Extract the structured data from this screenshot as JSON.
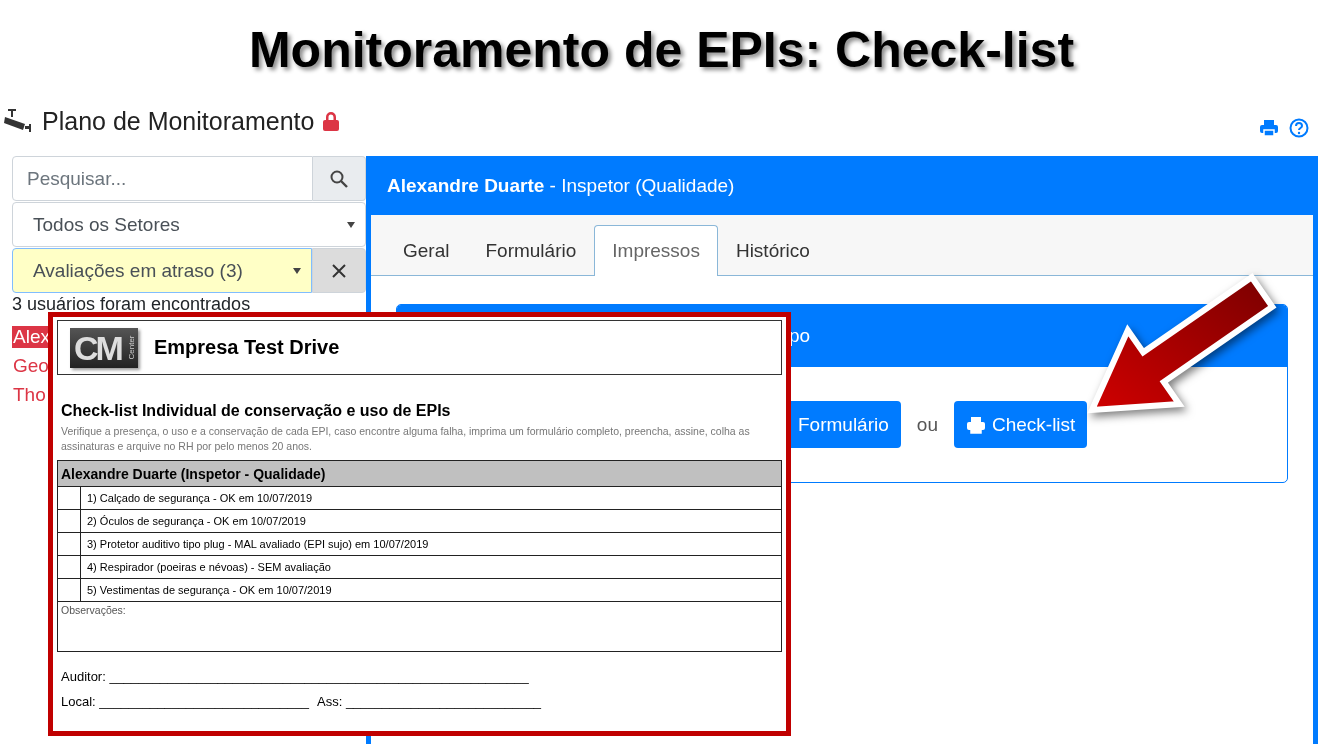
{
  "slide_title": "Monitoramento de EPIs: Check-list",
  "app": {
    "title": "Plano de Monitoramento",
    "locked": true
  },
  "sidebar": {
    "search": {
      "placeholder": "Pesquisar..."
    },
    "sector_select": {
      "value": "Todos os Setores",
      "highlighted": false
    },
    "filter_select": {
      "value": "Avaliações em atraso (3)",
      "highlighted": true
    },
    "result_count": "3 usuários foram encontrados",
    "users": [
      {
        "name": "Alex",
        "selected": true
      },
      {
        "name": "Geo",
        "selected": false
      },
      {
        "name": "Tho",
        "selected": false
      }
    ]
  },
  "panel": {
    "name": "Alexandre Duarte",
    "role": " - Inspetor (Qualidade)",
    "tabs": [
      {
        "label": "Geral",
        "selected": false
      },
      {
        "label": "Formulário",
        "selected": false
      },
      {
        "label": "Impressos",
        "selected": true
      },
      {
        "label": "Histórico",
        "selected": false
      }
    ],
    "card": {
      "title": "po",
      "separator": "ou",
      "buttons": [
        {
          "label": "Formulário",
          "icon": false
        },
        {
          "label": "Check-list",
          "icon": true
        }
      ]
    }
  },
  "document": {
    "logo": {
      "mark": "CM",
      "sub": "Center"
    },
    "company": "Empresa Test Drive",
    "title": "Check-list Individual de conservação e uso de EPIs",
    "description": "Verifique a presença, o uso e a conservação de cada EPI, caso encontre alguma falha, imprima um formulário completo, preencha, assine, colha as assinaturas e arquive no RH por pelo menos 20 anos.",
    "employee": "Alexandre Duarte (Inspetor - Qualidade)",
    "items": [
      "1) Calçado de segurança - OK em 10/07/2019",
      "2) Óculos de segurança - OK em 10/07/2019",
      "3) Protetor auditivo tipo plug - MAL avaliado (EPI sujo) em 10/07/2019",
      "4) Respirador (poeiras e névoas) - SEM avaliação",
      "5) Vestimentas de segurança - OK em 10/07/2019"
    ],
    "notes_label": "Observações:",
    "signature_lines": [
      [
        "Auditor: __________________________________________________________"
      ],
      [
        "Local: _____________________________",
        "Ass: ___________________________"
      ]
    ]
  }
}
